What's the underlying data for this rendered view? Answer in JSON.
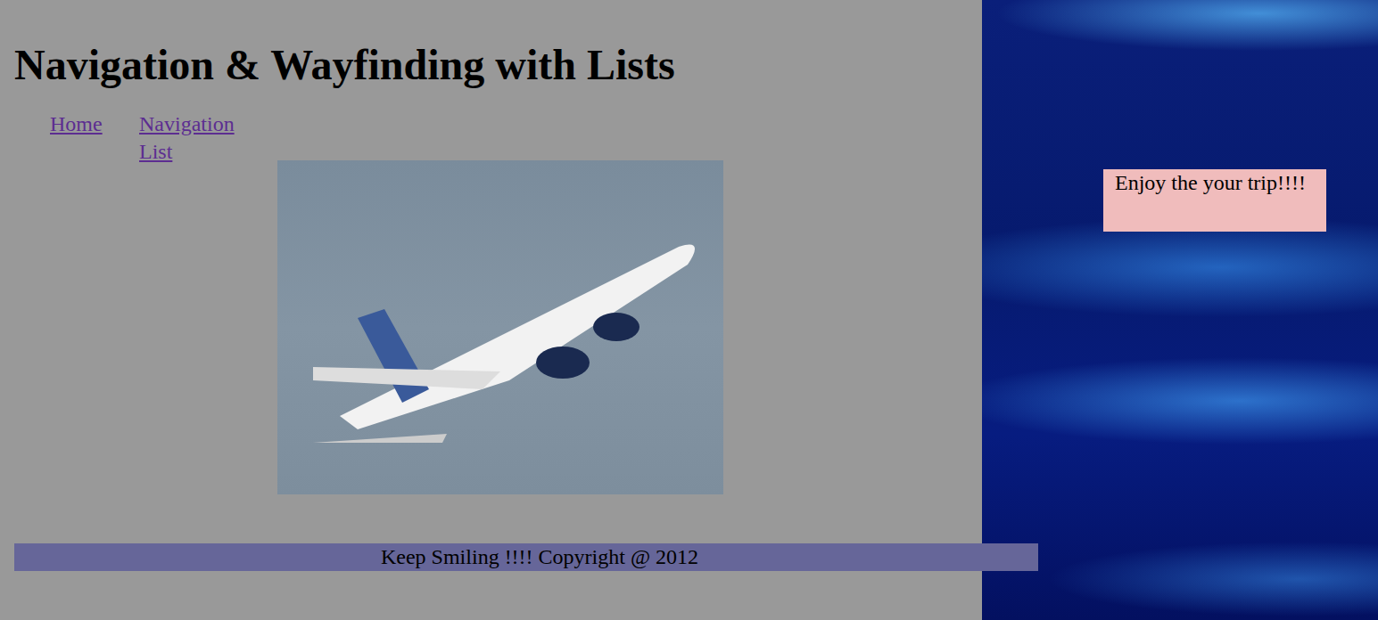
{
  "page": {
    "heading": "Navigation & Wayfinding with Lists"
  },
  "nav": {
    "items": [
      {
        "label": "Home",
        "visited": true
      },
      {
        "label": "Navigation List",
        "visited": true
      }
    ]
  },
  "photo": {
    "kind": "airplane-photo"
  },
  "aside": {
    "note": "Enjoy the your trip!!!!"
  },
  "footer": {
    "text": "Keep Smiling !!!! Copyright @ 2012"
  }
}
